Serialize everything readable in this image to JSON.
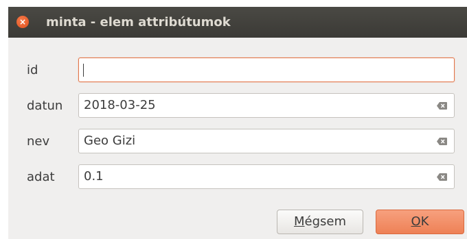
{
  "window": {
    "title": "minta - elem attribútumok",
    "close_glyph": "×"
  },
  "fields": [
    {
      "label": "id",
      "value": "",
      "focused": true
    },
    {
      "label": "datun",
      "value": "2018-03-25",
      "focused": false
    },
    {
      "label": "nev",
      "value": "Geo Gizi",
      "focused": false
    },
    {
      "label": "adat",
      "value": "0.1",
      "focused": false
    }
  ],
  "buttons": {
    "cancel_label": "Mégsem",
    "ok_label": "OK"
  },
  "icons": {
    "close": "close-icon",
    "clear": "clear-text-icon"
  },
  "colors": {
    "titlebar": "#3b3a36",
    "close_button": "#e2501d",
    "focus_border": "#e2764a",
    "ok_button": "#ee8156"
  }
}
